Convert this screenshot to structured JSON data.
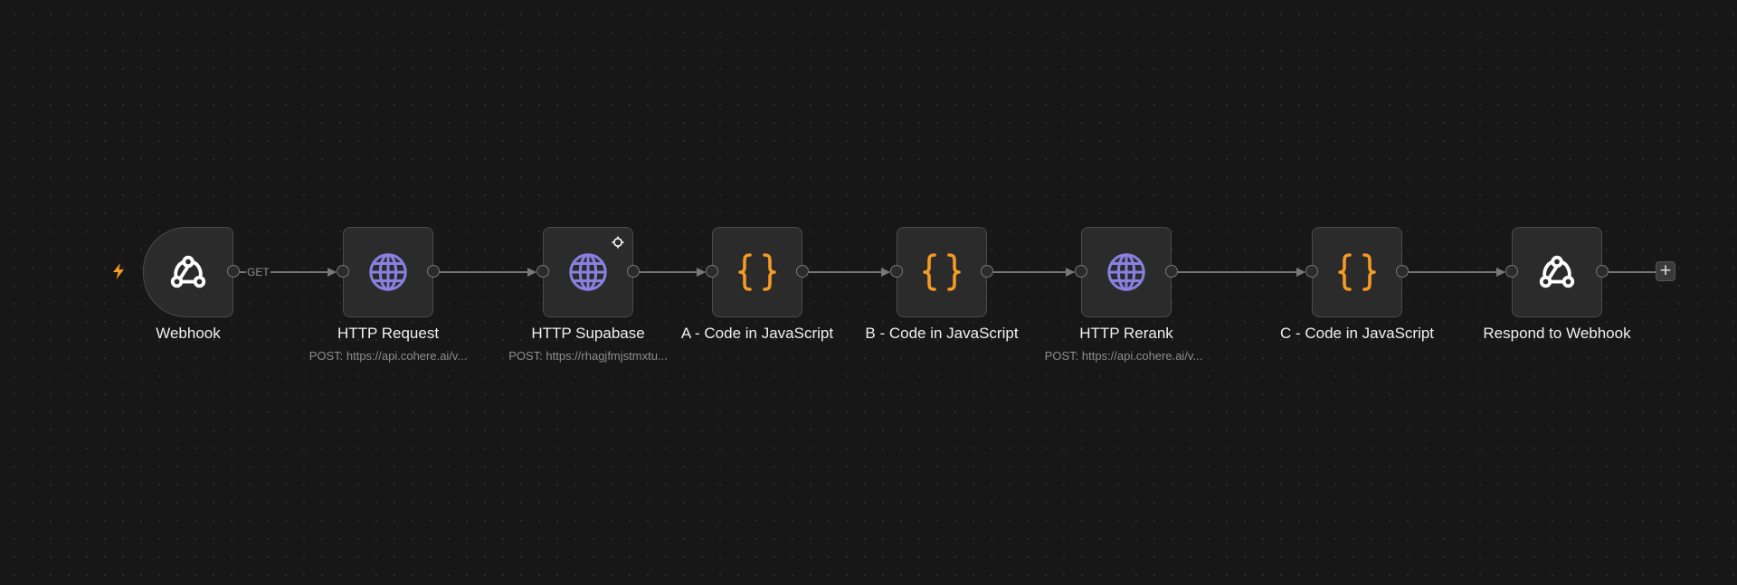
{
  "canvas": {
    "add_button_label": "+"
  },
  "nodes": [
    {
      "label": "Webhook",
      "subtitle": "",
      "icon": "webhook-icon",
      "edge_label": "GET"
    },
    {
      "label": "HTTP Request",
      "subtitle": "POST: https://api.cohere.ai/v...",
      "icon": "globe-icon"
    },
    {
      "label": "HTTP Supabase",
      "subtitle": "POST: https://rhagjfmjstmxtu...",
      "icon": "globe-icon",
      "pinned": true
    },
    {
      "label": "A - Code in JavaScript",
      "subtitle": "",
      "icon": "code-braces-icon"
    },
    {
      "label": "B - Code in JavaScript",
      "subtitle": "",
      "icon": "code-braces-icon"
    },
    {
      "label": "HTTP Rerank",
      "subtitle": "POST: https://api.cohere.ai/v...",
      "icon": "globe-icon"
    },
    {
      "label": "C - Code in JavaScript",
      "subtitle": "",
      "icon": "code-braces-icon"
    },
    {
      "label": "Respond to Webhook",
      "subtitle": "",
      "icon": "webhook-icon"
    }
  ],
  "colors": {
    "trigger_accent": "#f59a23",
    "http_icon": "#8b7fe0",
    "code_icon": "#f59a23",
    "webhook_icon": "#ffffff"
  }
}
